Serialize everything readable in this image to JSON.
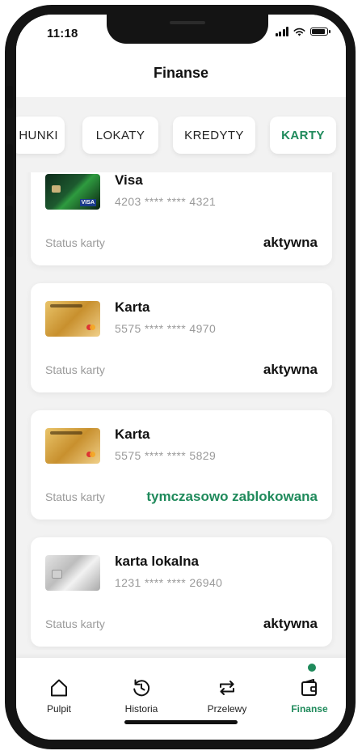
{
  "status_bar": {
    "time": "11:18"
  },
  "header": {
    "title": "Finanse"
  },
  "tabs": [
    {
      "label": "HUNKI",
      "active": false
    },
    {
      "label": "LOKATY",
      "active": false
    },
    {
      "label": "KREDYTY",
      "active": false
    },
    {
      "label": "KARTY",
      "active": true
    }
  ],
  "cards": [
    {
      "name": "Visa",
      "number": "4203 **** **** 4321",
      "status_label": "Status karty",
      "status": "aktywna",
      "image": "visa-card-image"
    },
    {
      "name": "Karta",
      "number": "5575 **** **** 4970",
      "status_label": "Status karty",
      "status": "aktywna",
      "image": "gold-mastercard-image"
    },
    {
      "name": "Karta",
      "number": "5575 **** **** 5829",
      "status_label": "Status karty",
      "status": "tymczasowo zablokowana",
      "image": "gold-mastercard-image"
    },
    {
      "name": "karta lokalna",
      "number": "1231 **** **** 26940",
      "status_label": "Status karty",
      "status": "aktywna",
      "image": "silver-card-image"
    }
  ],
  "nav": [
    {
      "label": "Pulpit",
      "icon": "home-icon",
      "active": false
    },
    {
      "label": "Historia",
      "icon": "history-icon",
      "active": false
    },
    {
      "label": "Przelewy",
      "icon": "transfer-icon",
      "active": false
    },
    {
      "label": "Finanse",
      "icon": "wallet-icon",
      "active": true
    }
  ],
  "colors": {
    "accent": "#1f8a5b",
    "background": "#f2f2f2",
    "card": "#ffffff"
  }
}
